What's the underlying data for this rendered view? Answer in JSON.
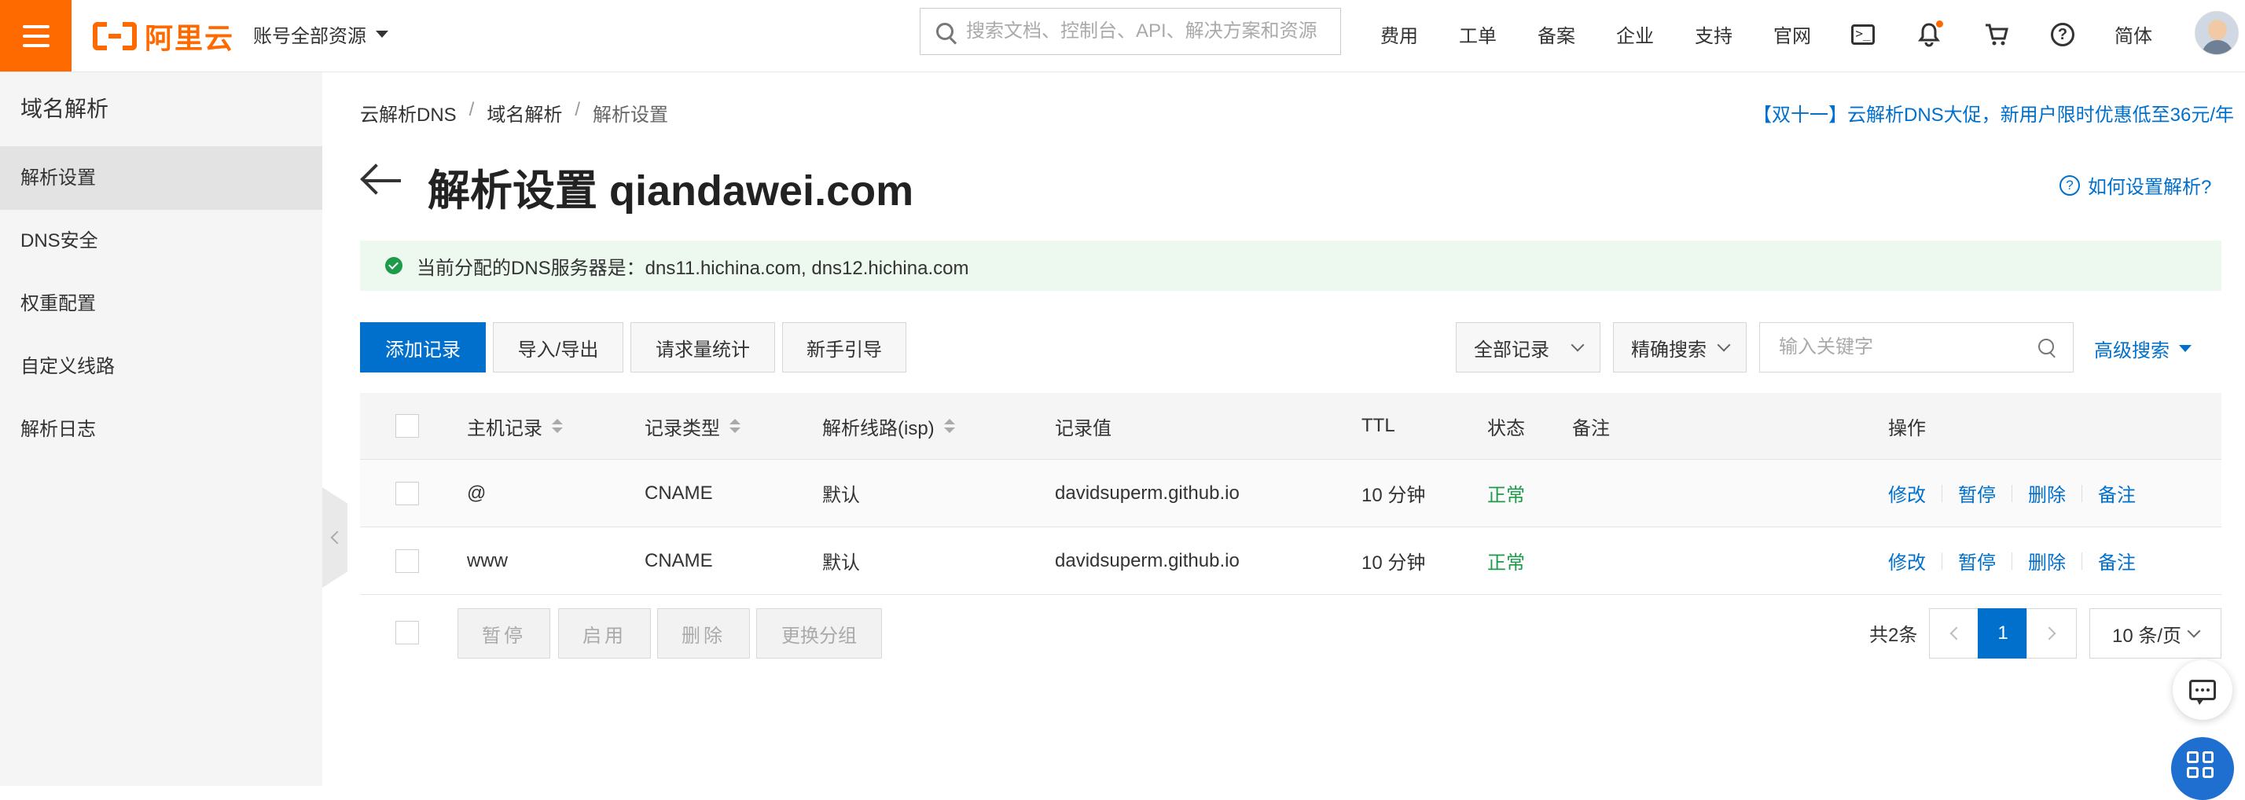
{
  "header": {
    "brand": "阿里云",
    "account_scope": "账号全部资源",
    "search_placeholder": "搜索文档、控制台、API、解决方案和资源",
    "nav": [
      "费用",
      "工单",
      "备案",
      "企业",
      "支持",
      "官网"
    ],
    "language": "简体",
    "icons": [
      "terminal-icon",
      "bell-icon",
      "cart-icon",
      "help-icon"
    ],
    "colors": {
      "brand": "#ff6a00",
      "link": "#0070cc",
      "success": "#1e9a4b"
    }
  },
  "sidebar": {
    "title": "域名解析",
    "items": [
      {
        "label": "解析设置",
        "active": true
      },
      {
        "label": "DNS安全"
      },
      {
        "label": "权重配置"
      },
      {
        "label": "自定义线路"
      },
      {
        "label": "解析日志"
      }
    ]
  },
  "breadcrumb": [
    "云解析DNS",
    "域名解析",
    "解析设置"
  ],
  "promo": "【双十一】云解析DNS大促，新用户限时优惠低至36元/年",
  "page": {
    "title": "解析设置 qiandawei.com",
    "help": "如何设置解析?",
    "notice": "当前分配的DNS服务器是：dns11.hichina.com, dns12.hichina.com"
  },
  "toolbar": {
    "add": "添加记录",
    "import_export": "导入/导出",
    "stats": "请求量统计",
    "guide": "新手引导",
    "filter_all": "全部记录",
    "filter_exact": "精确搜索",
    "keyword_placeholder": "输入关键字",
    "advanced": "高级搜索"
  },
  "table": {
    "headers": [
      "主机记录",
      "记录类型",
      "解析线路(isp)",
      "记录值",
      "TTL",
      "状态",
      "备注",
      "操作"
    ],
    "rows": [
      {
        "host": "@",
        "type": "CNAME",
        "line": "默认",
        "value": "davidsuperm.github.io",
        "ttl": "10 分钟",
        "status": "正常",
        "note": ""
      },
      {
        "host": "www",
        "type": "CNAME",
        "line": "默认",
        "value": "davidsuperm.github.io",
        "ttl": "10 分钟",
        "status": "正常",
        "note": ""
      }
    ],
    "actions": [
      "修改",
      "暂停",
      "删除",
      "备注"
    ]
  },
  "footer": {
    "batch": [
      "暂停",
      "启用",
      "删除",
      "更换分组"
    ],
    "total": "共2条",
    "page": "1",
    "page_size": "10 条/页"
  }
}
